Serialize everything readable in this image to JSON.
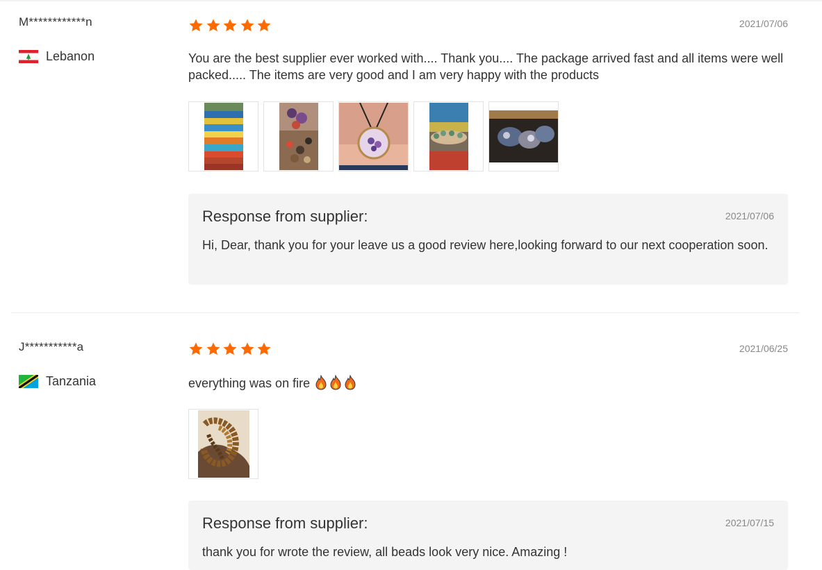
{
  "colors": {
    "star": "#ff6a00",
    "response_bg": "#f4f4f4"
  },
  "reviews": [
    {
      "user": "M************n",
      "country": "Lebanon",
      "flag_icon": "lebanon-flag-icon",
      "rating": 5,
      "date": "2021/07/06",
      "text": "You are the best supplier ever worked with.... Thank you.... The package arrived fast and all items were well packed..... The items are very good and I am very happy with the products",
      "images": [
        "colorful-seed-beads-photo",
        "mixed-gemstone-beads-photo",
        "tree-of-life-pendant-photo",
        "beaded-bracelet-photo",
        "beads-package-photo"
      ],
      "response": {
        "title": "Response from supplier:",
        "date": "2021/07/06",
        "text": "Hi, Dear, thank you for your leave us a good review here,looking forward to our next cooperation soon."
      }
    },
    {
      "user": "J***********a",
      "country": "Tanzania",
      "flag_icon": "tanzania-flag-icon",
      "rating": 5,
      "date": "2021/06/25",
      "text": "everything was on fire",
      "text_emoji": "fire-icon",
      "images": [
        "tiger-eye-beads-in-hand-photo"
      ],
      "response": {
        "title": "Response from supplier:",
        "date": "2021/07/15",
        "text": "thank you for wrote the review, all beads look very nice. Amazing !"
      }
    }
  ]
}
